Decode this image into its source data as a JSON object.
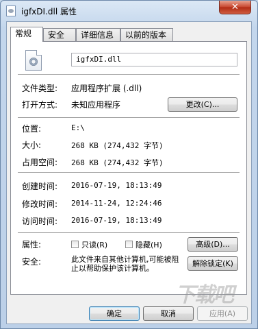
{
  "window": {
    "title": "igfxDI.dll 属性",
    "close": "✕"
  },
  "tabs": [
    "常规",
    "安全",
    "详细信息",
    "以前的版本"
  ],
  "general": {
    "file_name": "igfxDI.dll",
    "file_type_label": "文件类型:",
    "file_type_value": "应用程序扩展 (.dll)",
    "opens_with_label": "打开方式:",
    "opens_with_value": "未知应用程序",
    "change_button": "更改(C)...",
    "location_label": "位置:",
    "location_value": "E:\\",
    "size_label": "大小:",
    "size_value": "268 KB (274,432 字节)",
    "size_on_disk_label": "占用空间:",
    "size_on_disk_value": "268 KB (274,432 字节)",
    "created_label": "创建时间:",
    "created_value": "2016-07-19, 18:13:49",
    "modified_label": "修改时间:",
    "modified_value": "2014-11-24, 12:24:46",
    "accessed_label": "访问时间:",
    "accessed_value": "2016-07-19, 18:13:49",
    "attributes_label": "属性:",
    "readonly_label": "只读(R)",
    "hidden_label": "隐藏(H)",
    "advanced_button": "高级(D)...",
    "security_label": "安全:",
    "security_text": "此文件来自其他计算机,可能被阻止以帮助保护该计算机。",
    "unblock_button": "解除锁定(K)"
  },
  "footer": {
    "ok": "确定",
    "cancel": "取消",
    "apply": "应用(A)"
  },
  "watermark": "下载吧"
}
